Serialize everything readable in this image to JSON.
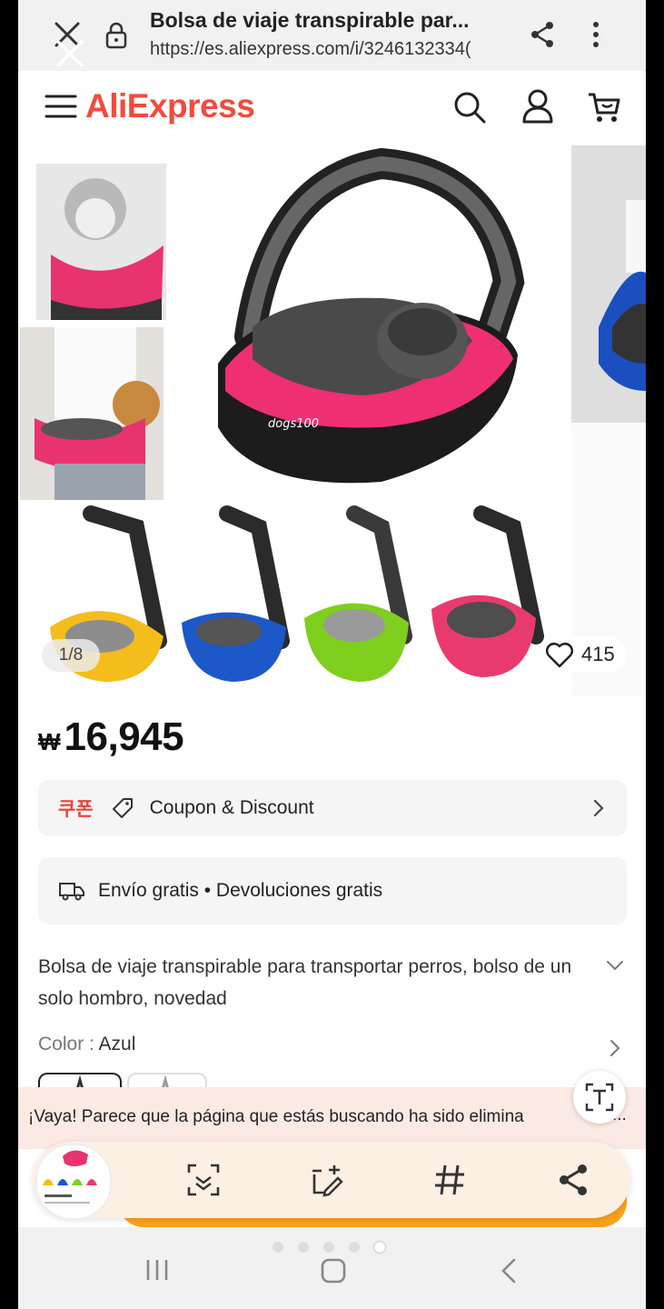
{
  "browser": {
    "title": "Bolsa de viaje transpirable par...",
    "url": "https://es.aliexpress.com/i/3246132334("
  },
  "header": {
    "logo_text": "AliExpress",
    "brand_color": "#f34a3d",
    "icons": [
      "menu-icon",
      "search-icon",
      "user-icon",
      "cart-icon"
    ]
  },
  "gallery": {
    "counter": "1/8",
    "likes": "415",
    "watermark": "dogs100"
  },
  "price": {
    "currency": "₩",
    "amount": "16,945"
  },
  "coupon": {
    "korean_label": "쿠폰",
    "label": "Coupon & Discount"
  },
  "shipping": {
    "label": "Envío gratis • Devoluciones gratis"
  },
  "product": {
    "description": "Bolsa de viaje transpirable para transportar perros, bolso de un solo hombro, novedad",
    "color_label": "Color :",
    "color_value": "Azul"
  },
  "banner": {
    "message": "¡Vaya! Parece que la página que estás buscando ha sido elimina",
    "ellipsis": "..."
  },
  "toolbar": {
    "icons": [
      "scan-icon",
      "add-edit-icon",
      "hashtag-icon",
      "share-icon"
    ]
  },
  "nav": {
    "icons": [
      "recents-icon",
      "home-icon",
      "back-icon"
    ]
  }
}
